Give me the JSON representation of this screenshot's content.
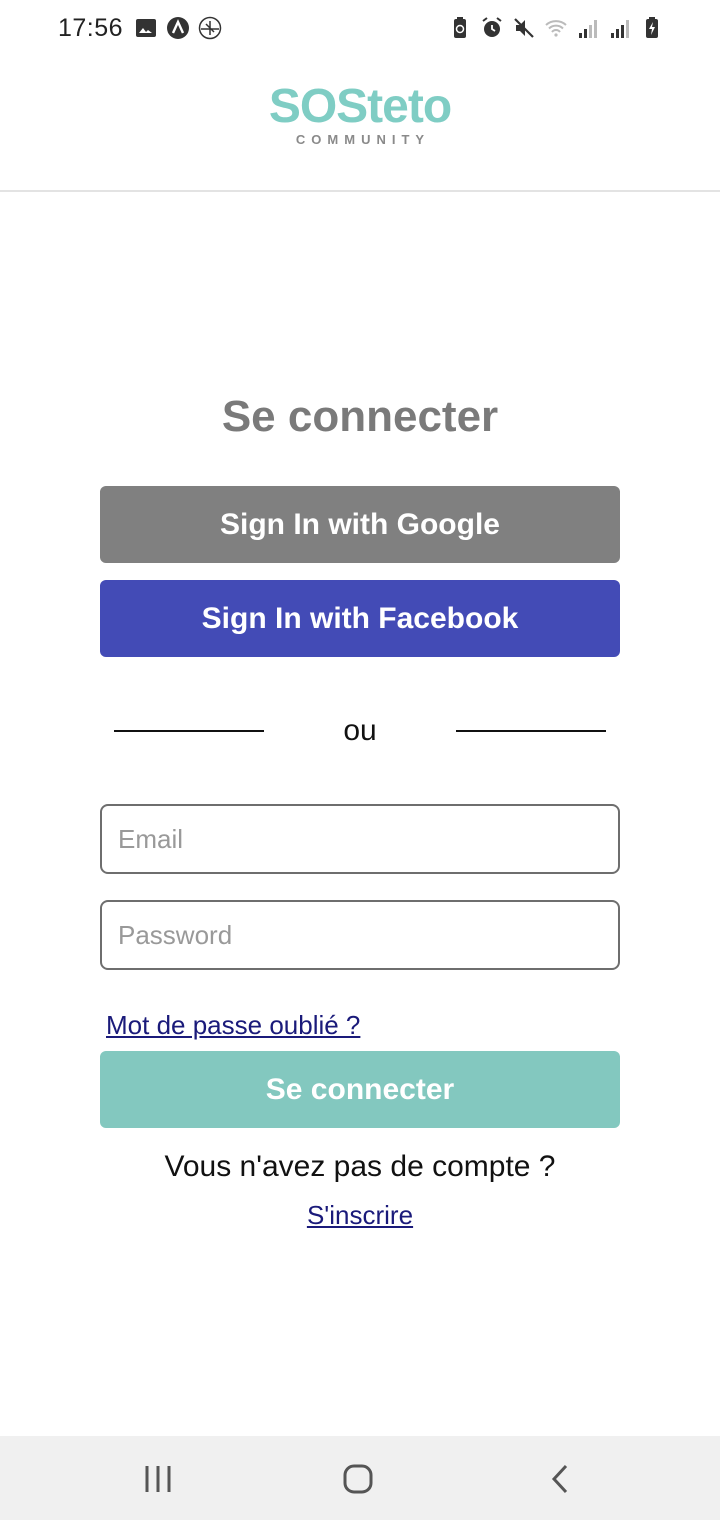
{
  "status_bar": {
    "time": "17:56",
    "left_icons": [
      "image-icon",
      "app-a-icon",
      "airplane-app-icon"
    ],
    "right_icons": [
      "battery-saver-icon",
      "alarm-icon",
      "mute-icon",
      "wifi-icon",
      "signal-1-icon",
      "signal-2-icon",
      "battery-charging-icon"
    ]
  },
  "header": {
    "logo_main": "SOSteto",
    "logo_sub": "COMMUNITY",
    "logo_color": "#7fcdc4"
  },
  "login": {
    "title": "Se connecter",
    "google_button": "Sign In with Google",
    "facebook_button": "Sign In with Facebook",
    "divider_text": "ou",
    "email_placeholder": "Email",
    "password_placeholder": "Password",
    "forgot_password": "Mot de passe oublié ?",
    "submit_button": "Se connecter",
    "no_account_text": "Vous n'avez pas de compte ?",
    "signup_link": "S'inscrire"
  },
  "colors": {
    "google": "#808080",
    "facebook": "#434bb6",
    "submit": "#83c8bf",
    "link": "#1a1a7a"
  },
  "nav_bar": {
    "icons": [
      "recents-icon",
      "home-icon",
      "back-icon"
    ]
  }
}
